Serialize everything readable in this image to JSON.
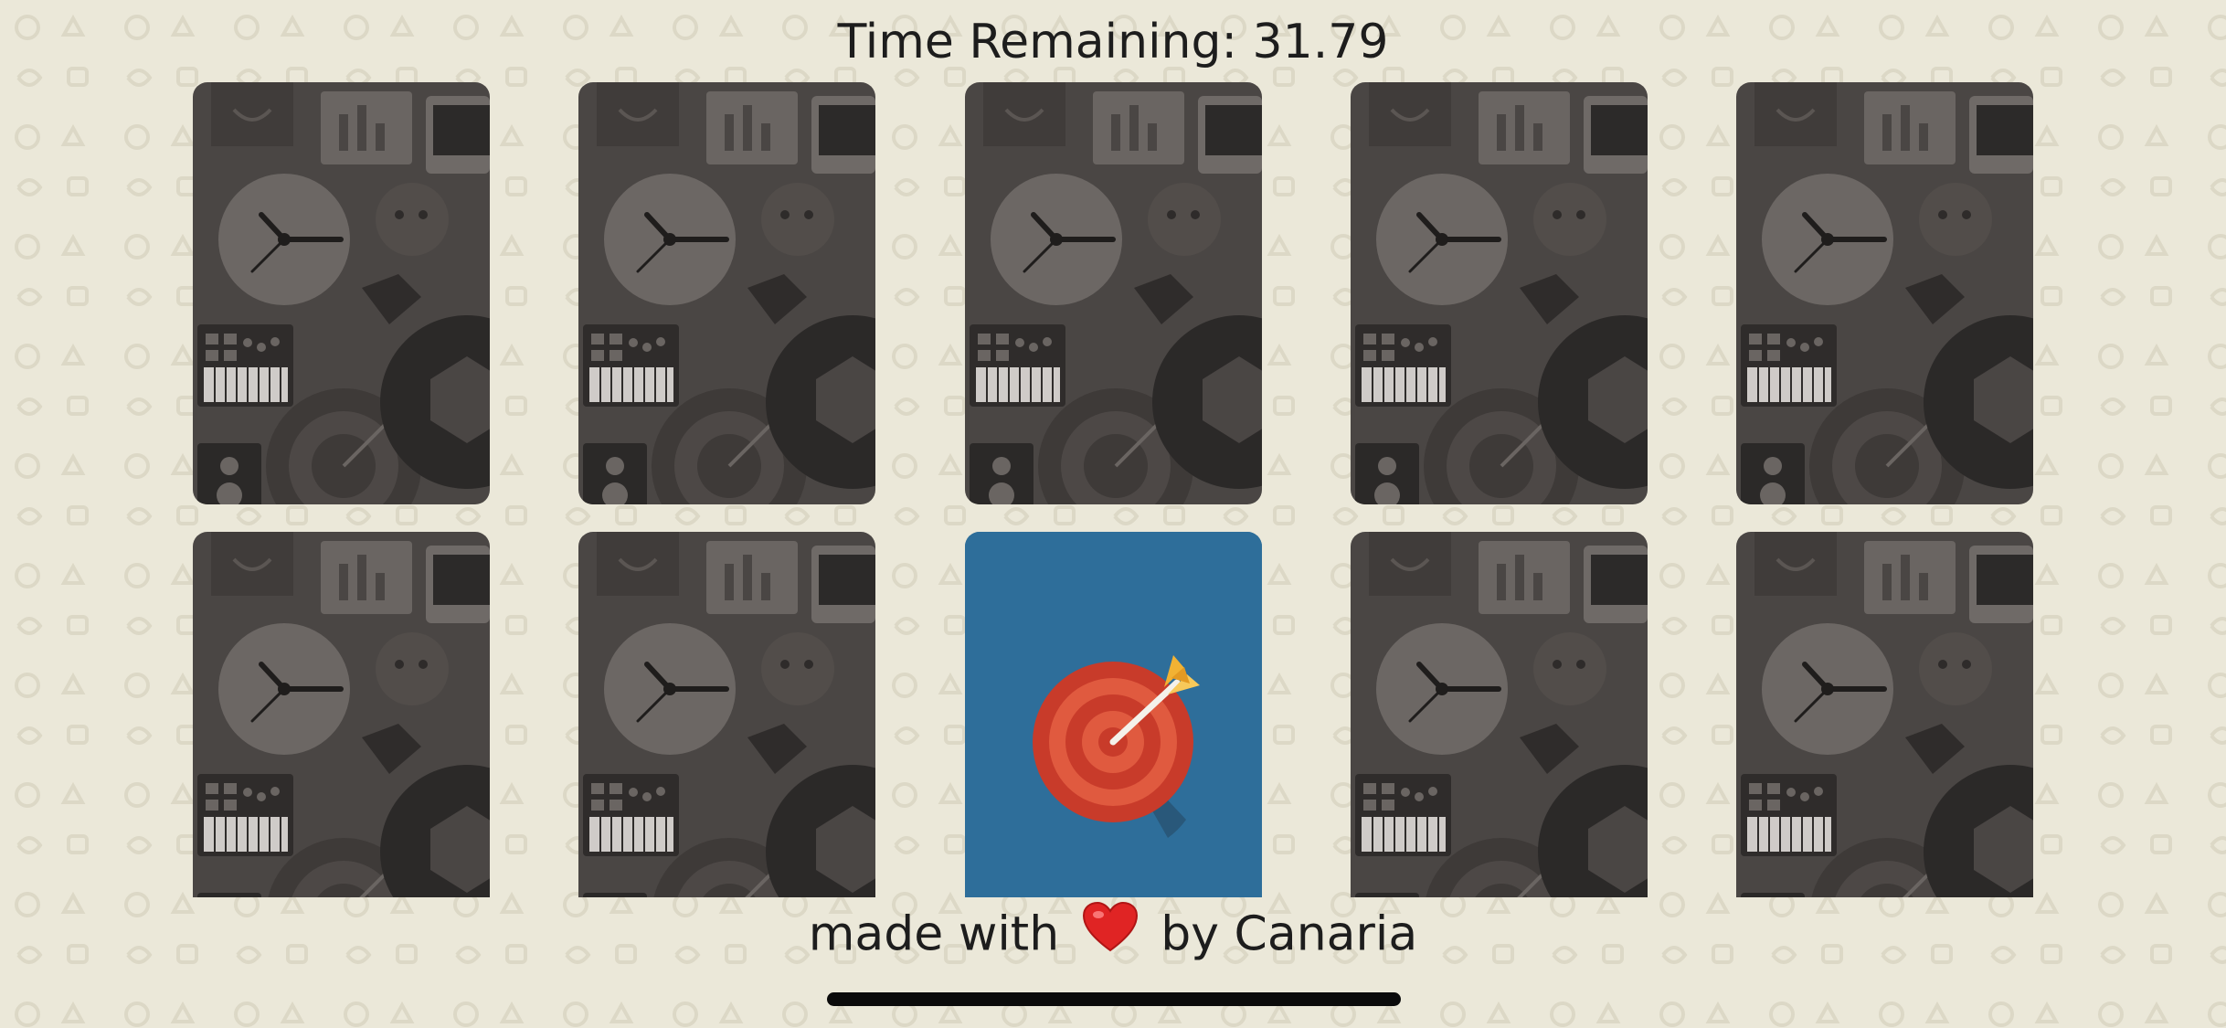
{
  "timer": {
    "label": "Time Remaining:",
    "value": "31.79"
  },
  "footer": {
    "prefix": "made with",
    "suffix": "by Canaria",
    "heart_icon": "heart-icon"
  },
  "board": {
    "rows": 2,
    "columns": 5,
    "cards": [
      {
        "state": "face-down",
        "icon": "card-back-pattern"
      },
      {
        "state": "face-down",
        "icon": "card-back-pattern"
      },
      {
        "state": "face-down",
        "icon": "card-back-pattern"
      },
      {
        "state": "face-down",
        "icon": "card-back-pattern"
      },
      {
        "state": "face-down",
        "icon": "card-back-pattern"
      },
      {
        "state": "face-down",
        "icon": "card-back-pattern"
      },
      {
        "state": "face-down",
        "icon": "card-back-pattern"
      },
      {
        "state": "face-up",
        "icon": "target-dart-icon",
        "face_color": "#2e6e9a"
      },
      {
        "state": "face-down",
        "icon": "card-back-pattern"
      },
      {
        "state": "face-down",
        "icon": "card-back-pattern"
      }
    ]
  },
  "colors": {
    "background": "#ebe8d9",
    "card_back": "#4a4644",
    "card_face": "#2e6e9a",
    "target_red": "#d5412e",
    "arrow_gold": "#f2b233"
  }
}
